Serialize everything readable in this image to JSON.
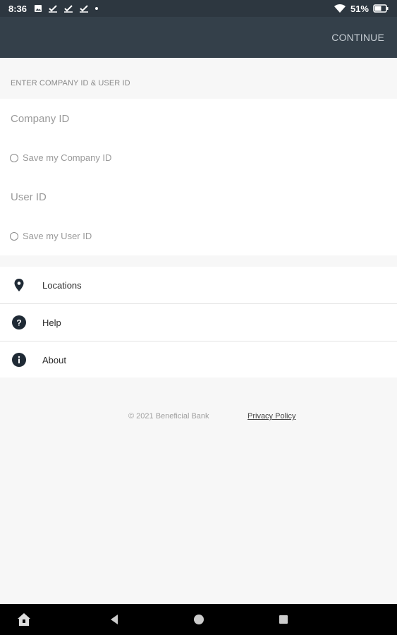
{
  "status_bar": {
    "time": "8:36",
    "battery": "51%",
    "icons": [
      "image-notification-icon",
      "check-notification-icon",
      "check-notification-icon",
      "check-notification-icon",
      "dot-icon",
      "wifi-icon",
      "battery-icon"
    ]
  },
  "app_bar": {
    "continue_label": "CONTINUE"
  },
  "form": {
    "section_header": "ENTER COMPANY ID & USER ID",
    "company_id_placeholder": "Company ID",
    "save_company_id_label": "Save my Company ID",
    "user_id_placeholder": "User ID",
    "save_user_id_label": "Save my User ID"
  },
  "menu": {
    "items": [
      {
        "label": "Locations",
        "icon": "location-pin-icon"
      },
      {
        "label": "Help",
        "icon": "help-icon"
      },
      {
        "label": "About",
        "icon": "info-icon"
      }
    ]
  },
  "footer": {
    "copyright": "© 2021 Beneficial Bank",
    "privacy_link": "Privacy Policy"
  },
  "colors": {
    "app_bar": "#34404a",
    "status_bar": "#2d3740",
    "background": "#f7f7f7",
    "icon_dark": "#1f2a35"
  },
  "nav_bar": {
    "buttons": [
      "home-app-icon",
      "back-icon",
      "home-icon",
      "recents-icon"
    ]
  }
}
